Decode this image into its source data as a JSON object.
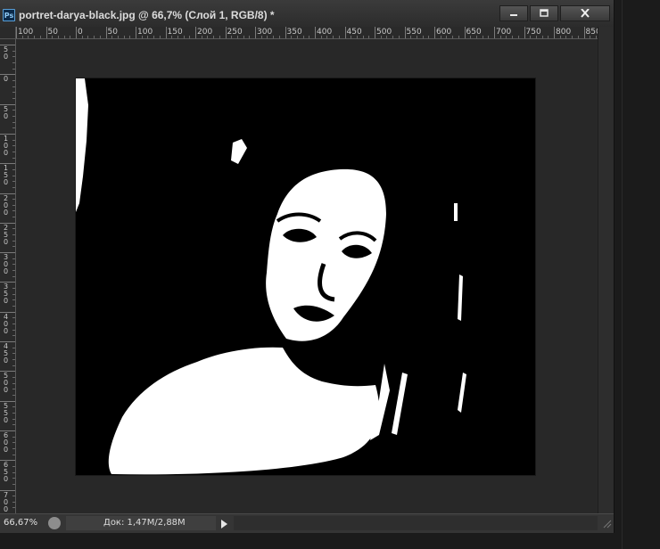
{
  "window": {
    "app_icon_text": "Ps",
    "title": "portret-darya-black.jpg @ 66,7% (Слой 1, RGB/8) *",
    "minimize_icon": "minimize-icon",
    "maximize_icon": "maximize-icon",
    "close_icon": "close-icon"
  },
  "rulers": {
    "horizontal_labels": [
      "100",
      "50",
      "0",
      "50",
      "100",
      "150",
      "200",
      "250",
      "300",
      "350",
      "400",
      "450",
      "500",
      "550",
      "600",
      "650",
      "700",
      "750",
      "800",
      "850"
    ],
    "vertical_labels": [
      "50",
      "0",
      "50",
      "100",
      "150",
      "200",
      "250",
      "300",
      "350",
      "400",
      "450",
      "500",
      "550",
      "600",
      "650",
      "700"
    ]
  },
  "canvas": {
    "image_description_icon": "portrait-image",
    "colors": {
      "background": "#282828",
      "artwork_bg": "#000000",
      "artwork_fg": "#ffffff"
    }
  },
  "status": {
    "zoom": "66,67%",
    "doc_info": "Док: 1,47M/2,88M",
    "status_icon": "info-icon",
    "arrow_icon": "play-arrow-icon"
  }
}
